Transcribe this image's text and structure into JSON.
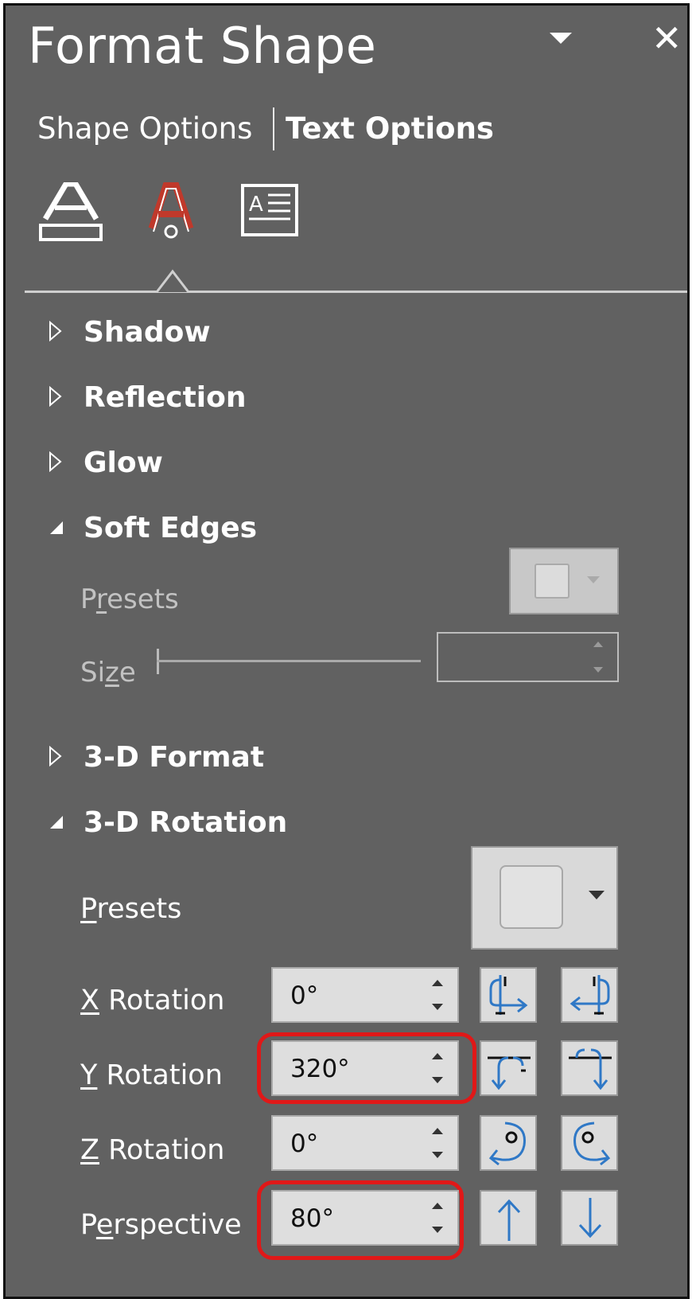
{
  "header": {
    "title": "Format Shape",
    "dropdown_icon": "chevron-down-icon",
    "close_icon": "close-icon"
  },
  "tabs": [
    {
      "label": "Shape Options",
      "selected": false
    },
    {
      "label": "Text Options",
      "selected": true
    }
  ],
  "icon_tabs": [
    {
      "name": "text-fill-outline-icon"
    },
    {
      "name": "text-effects-icon",
      "selected": true,
      "color": "#c0392b"
    },
    {
      "name": "textbox-icon"
    }
  ],
  "sections": {
    "shadow": {
      "label": "Shadow",
      "expanded": false
    },
    "reflection": {
      "label": "Reflection",
      "expanded": false
    },
    "glow": {
      "label": "Glow",
      "expanded": false
    },
    "soft_edges": {
      "label": "Soft Edges",
      "expanded": true,
      "presets_pre": "P",
      "presets_u": "r",
      "presets_post": "esets",
      "size_pre": "Si",
      "size_u": "z",
      "size_post": "e",
      "disabled": true
    },
    "format_3d": {
      "label": "3-D Format",
      "expanded": false
    },
    "rotation_3d": {
      "label": "3-D Rotation",
      "expanded": true,
      "presets_u": "P",
      "presets_post": "resets",
      "x_u": "X",
      "x_post": " Rotation",
      "x_value": "0°",
      "y_u": "Y",
      "y_post": " Rotation",
      "y_value": "320°",
      "z_u": "Z",
      "z_post": " Rotation",
      "z_value": "0°",
      "persp_pre": "P",
      "persp_u": "e",
      "persp_post": "rspective",
      "persp_value": "80°"
    }
  },
  "colors": {
    "panel_bg": "#616161",
    "highlight": "#e01818",
    "icon_blue": "#2f78c6"
  }
}
